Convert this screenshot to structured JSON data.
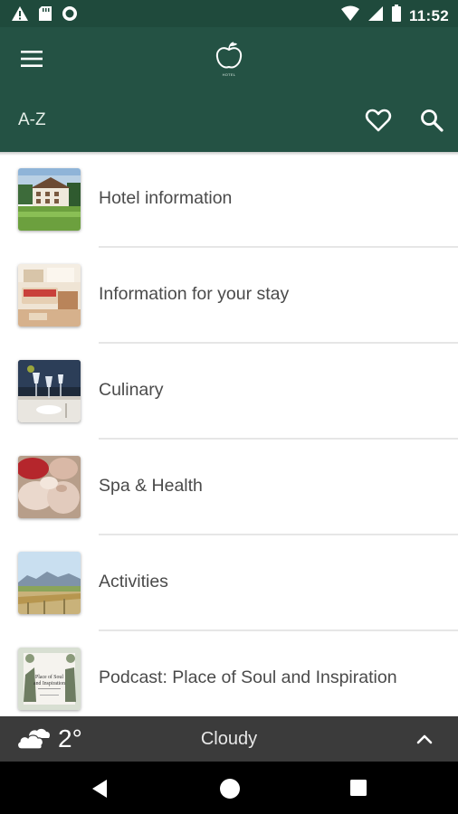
{
  "status_bar": {
    "time": "11:52",
    "left_icons": [
      "warning-icon",
      "sd-card-icon",
      "record-circle-icon"
    ],
    "right_icons": [
      "wifi-icon",
      "cell-signal-icon",
      "battery-icon"
    ]
  },
  "app_bar": {
    "logo_text": "HOTEL",
    "title": "A-Z",
    "icons": [
      "menu-icon",
      "apple-logo-icon",
      "heart-icon",
      "search-icon"
    ],
    "color": "#245244"
  },
  "list": {
    "items": [
      {
        "label": "Hotel information",
        "thumb": "hotel-exterior-image"
      },
      {
        "label": "Information for your stay",
        "thumb": "hotel-room-image"
      },
      {
        "label": "Culinary",
        "thumb": "dining-table-image"
      },
      {
        "label": "Spa & Health",
        "thumb": "spa-towels-image"
      },
      {
        "label": "Activities",
        "thumb": "mountain-meadow-image"
      },
      {
        "label": "Podcast: Place of Soul and Inspiration",
        "thumb": "podcast-cover-image"
      }
    ]
  },
  "podcast_thumb": {
    "line1": "Place of Soul",
    "line2": "and Inspiration"
  },
  "weather": {
    "temperature": "2°",
    "condition": "Cloudy",
    "icon": "cloud-icon"
  },
  "nav_bar": {
    "icons": [
      "back-icon",
      "home-icon",
      "recents-icon"
    ]
  }
}
